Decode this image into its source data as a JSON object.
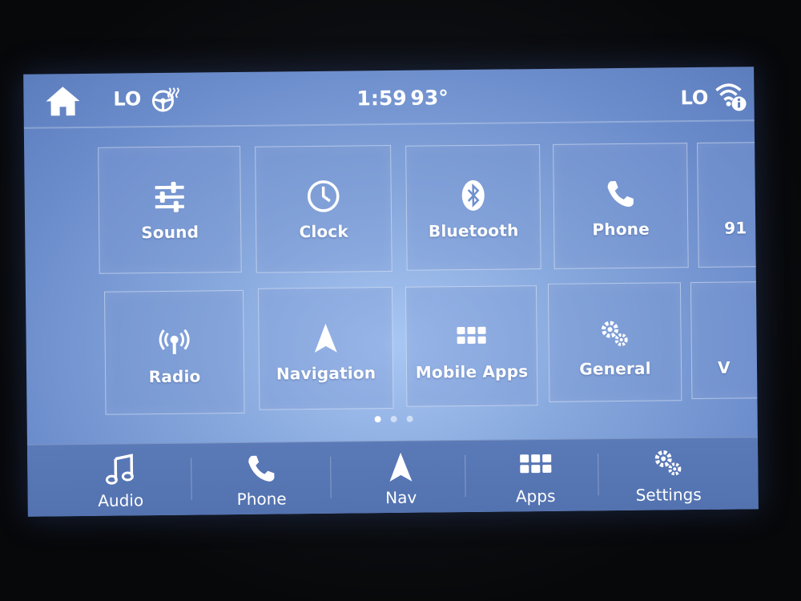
{
  "status": {
    "left_level": "LO",
    "time": "1:59",
    "temperature": "93°",
    "right_level": "LO",
    "home_icon": "home-icon",
    "heated_wheel_icon": "heated-steering-wheel-icon",
    "wifi_icon": "wifi-info-icon"
  },
  "tiles": [
    {
      "label": "Sound",
      "icon": "sliders-icon"
    },
    {
      "label": "Clock",
      "icon": "clock-icon"
    },
    {
      "label": "Bluetooth",
      "icon": "bluetooth-icon"
    },
    {
      "label": "Phone",
      "icon": "phone-icon"
    },
    {
      "label": "91",
      "icon": ""
    },
    {
      "label": "Radio",
      "icon": "radio-icon"
    },
    {
      "label": "Navigation",
      "icon": "navigation-arrow-icon"
    },
    {
      "label": "Mobile Apps",
      "icon": "grid-icon"
    },
    {
      "label": "General",
      "icon": "gears-icon"
    },
    {
      "label": "V",
      "icon": ""
    }
  ],
  "pager": {
    "pages": 3,
    "active": 1
  },
  "bottom_nav": [
    {
      "label": "Audio",
      "icon": "music-note-icon"
    },
    {
      "label": "Phone",
      "icon": "phone-icon"
    },
    {
      "label": "Nav",
      "icon": "navigation-arrow-icon"
    },
    {
      "label": "Apps",
      "icon": "grid-icon"
    },
    {
      "label": "Settings",
      "icon": "gears-icon"
    }
  ],
  "colors": {
    "screen_center": "#a9c7f4",
    "screen_edge": "#5c7dbd",
    "bottom_bar": "#5573b2",
    "text": "#ffffff"
  }
}
